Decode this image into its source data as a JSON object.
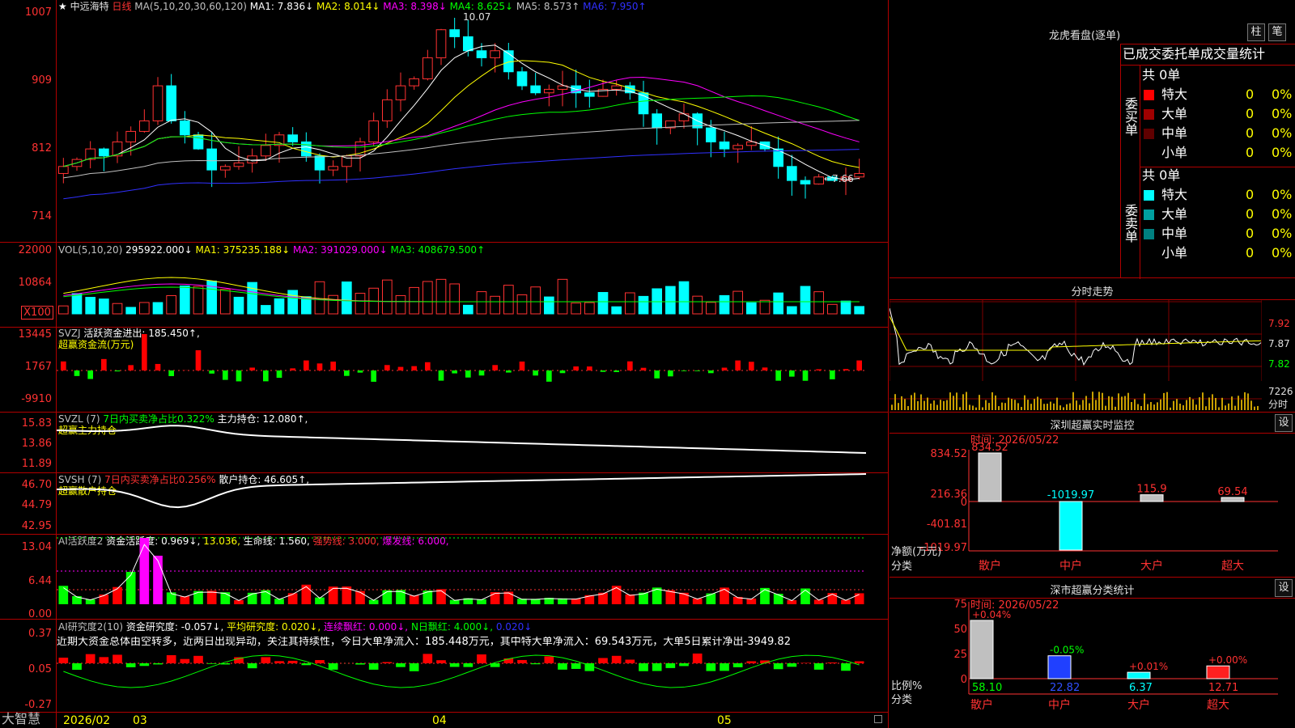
{
  "stock": {
    "star": "★",
    "name": "中远海特",
    "period": "日线"
  },
  "main": {
    "ma_params": "MA(5,10,20,30,60,120)",
    "ma": [
      {
        "label": "MA1: 7.836↓",
        "color": "#ffffff"
      },
      {
        "label": "MA2: 8.014↓",
        "color": "#ffff00"
      },
      {
        "label": "MA3: 8.398↓",
        "color": "#ff00ff"
      },
      {
        "label": "MA4: 8.625↓",
        "color": "#00ff00"
      },
      {
        "label": "MA5: 8.573↑",
        "color": "#c0c0c0"
      },
      {
        "label": "MA6: 7.950↑",
        "color": "#3030ff"
      }
    ],
    "axis": [
      "1007",
      "909",
      "812",
      "714"
    ],
    "high_note": "10.07",
    "low_note": "←7.66"
  },
  "vol": {
    "params": "VOL(5,10,20)",
    "value": "295922.000↓",
    "ma1": "MA1: 375235.188↓",
    "ma2": "MA2: 391029.000↓",
    "ma3": "MA3: 408679.500↑",
    "axis": [
      "22000",
      "10864",
      "X100"
    ]
  },
  "svzj": {
    "name": "SVZJ",
    "active": "活跃资金进出: 185.450↑,",
    "sub": "超赢资金流(万元)",
    "axis": [
      "13445",
      "1767",
      "-9910"
    ]
  },
  "svzl": {
    "name": "SVZL (7)",
    "ratio": "7日内买卖净占比0.322%",
    "hold": "主力持仓: 12.080↑,",
    "sub": "超赢主力持仓",
    "axis": [
      "15.83",
      "13.86",
      "11.89"
    ]
  },
  "svsh": {
    "name": "SVSH (7)",
    "ratio": "7日内买卖净占比0.256%",
    "hold": "散户持仓: 46.605↑,",
    "sub": "超赢散户持仓",
    "axis": [
      "46.70",
      "44.79",
      "42.95"
    ]
  },
  "ai1": {
    "name": "AI活跃度2",
    "active": "资金活跃度: 0.969↓,",
    "v2": "13.036,",
    "life": "生命线: 1.560,",
    "strong": "强势线: 3.000,",
    "burst": "爆发线: 6.000,",
    "axis": [
      "13.04",
      "6.44",
      "0.00"
    ]
  },
  "ai2": {
    "name": "AI研究度2(10)",
    "research": "资金研究度: -0.057↓,",
    "avg": "平均研究度: 0.020↓,",
    "red": "连续飘红: 0.000↓,",
    "nred": "N日飘红: 4.000↓,",
    "last": "0.020↓",
    "axis": [
      "0.37",
      "0.05",
      "-0.27"
    ],
    "comment": "近期大资金总体由空转多，近两日出现异动，关注其持续性，今日大单净流入：185.448万元，其中特大单净流入：69.543万元，大单5日累计净出-3949.82"
  },
  "dates": [
    "2026/02",
    "03",
    "04",
    "05"
  ],
  "brand": "大智慧",
  "lhb": {
    "title": "龙虎看盘(逐单)",
    "btn1": "柱",
    "btn2": "笔",
    "tab": "已成交委托单成交量统计",
    "buy": {
      "side": "委买单",
      "total": "共 0单",
      "rows": [
        {
          "label": "特大",
          "color": "#ff0000",
          "n": "0",
          "p": "0%"
        },
        {
          "label": "大单",
          "color": "#a00000",
          "n": "0",
          "p": "0%"
        },
        {
          "label": "中单",
          "color": "#600000",
          "n": "0",
          "p": "0%"
        },
        {
          "label": "小单",
          "color": "",
          "n": "0",
          "p": "0%"
        }
      ]
    },
    "sell": {
      "side": "委卖单",
      "total": "共 0单",
      "rows": [
        {
          "label": "特大",
          "color": "#00ffff",
          "n": "0",
          "p": "0%"
        },
        {
          "label": "大单",
          "color": "#00a0a0",
          "n": "0",
          "p": "0%"
        },
        {
          "label": "中单",
          "color": "#008080",
          "n": "0",
          "p": "0%"
        },
        {
          "label": "小单",
          "color": "",
          "n": "0",
          "p": "0%"
        }
      ]
    }
  },
  "tick": {
    "title": "分时走势",
    "axis": [
      "7.92",
      "7.87",
      "7.82",
      "7226",
      "分时"
    ]
  },
  "monitor": {
    "title": "深圳超赢实时监控",
    "btn": "设",
    "time": "时间: 2026/05/22",
    "axis": [
      "834.52",
      "216.36",
      "0",
      "-401.81",
      "-1019.97"
    ],
    "ylabel": "净额(万元)",
    "xlabel": "分类",
    "bars": [
      {
        "cat": "散户",
        "value": "834.52"
      },
      {
        "cat": "中户",
        "value": "-1019.97"
      },
      {
        "cat": "大户",
        "value": "115.9"
      },
      {
        "cat": "超大",
        "value": "69.54"
      }
    ]
  },
  "classify": {
    "title": "深市超赢分类统计",
    "btn": "设",
    "time": "时间: 2026/05/22",
    "axis": [
      "75",
      "50",
      "25",
      "0"
    ],
    "ylabel": "比例%",
    "xlabel": "分类",
    "bars": [
      {
        "cat": "散户",
        "value": "58.10",
        "chg": "+0.04%"
      },
      {
        "cat": "中户",
        "value": "22.82",
        "chg": "-0.05%"
      },
      {
        "cat": "大户",
        "value": "6.37",
        "chg": "+0.01%"
      },
      {
        "cat": "超大",
        "value": "12.71",
        "chg": "+0.00%"
      }
    ]
  }
}
